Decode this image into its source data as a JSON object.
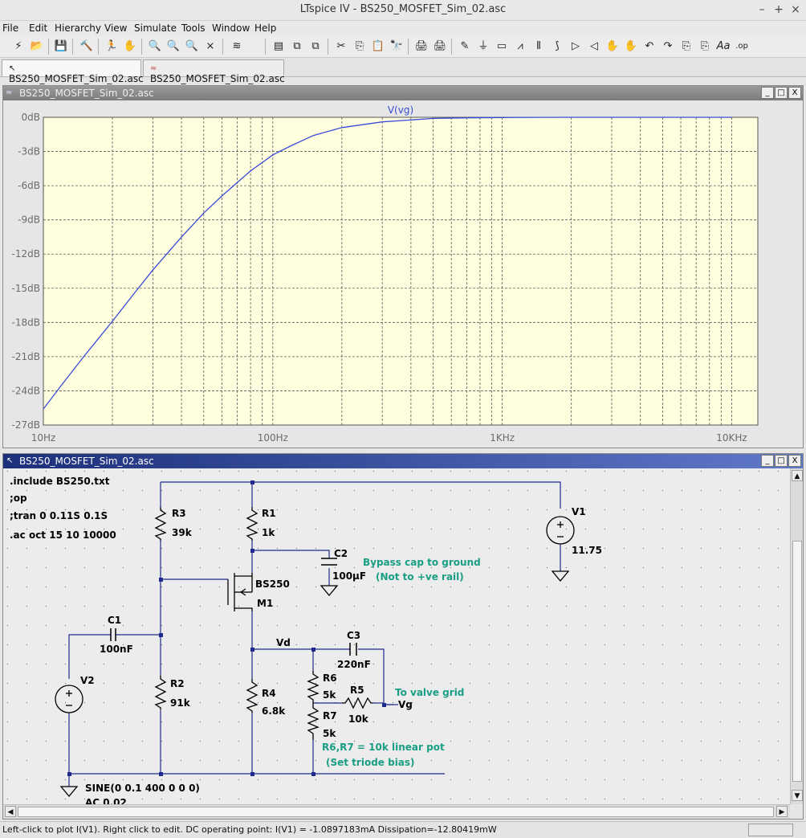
{
  "window": {
    "title": "LTspice IV - BS250_MOSFET_Sim_02.asc",
    "min": "–",
    "max": "+",
    "close": "×"
  },
  "menu": [
    "File",
    "Edit",
    "Hierarchy",
    "View",
    "Simulate",
    "Tools",
    "Window",
    "Help"
  ],
  "tabs": [
    {
      "label": "BS250_MOSFET_Sim_02.asc",
      "icon": "schematic-icon"
    },
    {
      "label": "BS250_MOSFET_Sim_02.asc",
      "icon": "waveform-icon"
    }
  ],
  "toolbar": [
    "⚡",
    "📂",
    "💾",
    "🔨",
    "🏃",
    "✋",
    "🔍",
    "🔍",
    "🔍",
    "⨯",
    "≋",
    "▤",
    "⧉",
    "⧉",
    "✂",
    "⎘",
    "📋",
    "🔭",
    "🖨",
    "🖨",
    "✎",
    "⏚",
    "▭",
    "⩘",
    "⫴",
    "⟆",
    "▷",
    "◁",
    "✋",
    "✋",
    "↶",
    "↷",
    "⎘",
    "⎘",
    "Aa",
    ".op"
  ],
  "plot_window": {
    "title": "BS250_MOSFET_Sim_02.asc",
    "btn_min": "_",
    "btn_max": "□",
    "btn_close": "X"
  },
  "chart_data": {
    "type": "line",
    "trace_label": "V(vg)",
    "xscale": "log",
    "xlim": [
      10,
      13000
    ],
    "ylim": [
      -27,
      0
    ],
    "yticks": [
      "0dB",
      "-3dB",
      "-6dB",
      "-9dB",
      "-12dB",
      "-15dB",
      "-18dB",
      "-21dB",
      "-24dB",
      "-27dB"
    ],
    "xticks": [
      {
        "value": 10,
        "label": "10Hz"
      },
      {
        "value": 100,
        "label": "100Hz"
      },
      {
        "value": 1000,
        "label": "1KHz"
      },
      {
        "value": 10000,
        "label": "10KHz"
      }
    ],
    "grid": true,
    "series": [
      {
        "color": "#3a4bd8",
        "x": [
          10,
          12,
          15,
          20,
          25,
          30,
          40,
          50,
          60,
          80,
          100,
          120,
          150,
          200,
          300,
          500,
          700,
          1000,
          2000,
          5000,
          10000
        ],
        "y": [
          -25.6,
          -23.5,
          -21.0,
          -17.9,
          -15.4,
          -13.4,
          -10.5,
          -8.4,
          -6.9,
          -4.7,
          -3.3,
          -2.5,
          -1.6,
          -0.9,
          -0.4,
          -0.1,
          -0.05,
          -0.02,
          0,
          0,
          0
        ]
      }
    ],
    "background": "#ffffe0"
  },
  "schematic_window": {
    "title": "BS250_MOSFET_Sim_02.asc",
    "btn_min": "_",
    "btn_max": "□",
    "btn_close": "X"
  },
  "schematic": {
    "directives": [
      ".include BS250.txt",
      ";op",
      ";tran 0 0.11S 0.1S",
      ".ac oct 15 10 10000"
    ],
    "components": {
      "R3": "R3",
      "R3v": "39k",
      "R1": "R1",
      "R1v": "1k",
      "C2": "C2",
      "C2v": "100µF",
      "M1n": "BS250",
      "M1": "M1",
      "C1": "C1",
      "C1v": "100nF",
      "V2": "V2",
      "R2": "R2",
      "R2v": "91k",
      "R4": "R4",
      "R4v": "6.8k",
      "C3": "C3",
      "C3v": "220nF",
      "R6": "R6",
      "R6v": "5k",
      "R5": "R5",
      "R5v": "10k",
      "R7": "R7",
      "R7v": "5k",
      "V1": "V1",
      "V1v": "11.75",
      "V2src": "SINE(0 0.1 400 0 0 0)",
      "V2ac": "AC 0.02"
    },
    "nets": {
      "vd": "Vd",
      "vg": "Vg"
    },
    "comments": {
      "c1": "Bypass cap to ground",
      "c2": "(Not to +ve rail)",
      "c3": "To valve grid",
      "c4": "R6,R7 = 10k linear pot",
      "c5": "(Set triode bias)"
    },
    "colors": {
      "wire": "#1e2a8c",
      "comp": "#000000",
      "comment": "#199e84",
      "bg": "#ececec",
      "dots": "#4a4a4a"
    }
  },
  "status": "Left-click to plot I(V1).  Right click to edit.  DC operating point: I(V1) = -1.0897183mA   Dissipation=-12.80419mW"
}
